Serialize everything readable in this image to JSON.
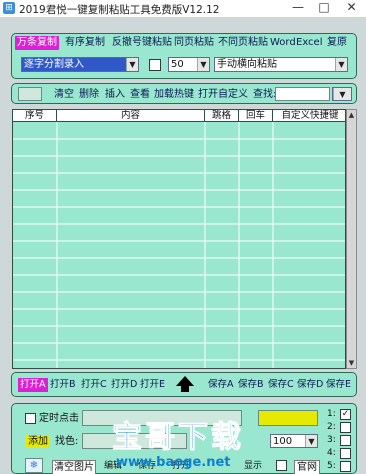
{
  "window": {
    "title": "2019君悦一键复制粘贴工具免费版V12.12",
    "app_icon": "app-icon",
    "minimize": "—",
    "maximize": "□",
    "close": "✕"
  },
  "tabs": [
    {
      "label": "万条复制",
      "active": true
    },
    {
      "label": "有序复制"
    },
    {
      "label": "反撤号键粘贴"
    },
    {
      "label": "同页粘贴"
    },
    {
      "label": "不同页粘贴"
    },
    {
      "label": "Word"
    },
    {
      "label": "Excel"
    },
    {
      "label": "复原"
    }
  ],
  "options": {
    "input_mode": "逐字分割录入",
    "count": "50",
    "paste_mode": "手动横向粘贴"
  },
  "toolbar": {
    "items": [
      "清空",
      "删除",
      "插入",
      "查看",
      "加载热键",
      "打开自定义"
    ],
    "search_label": "查找:"
  },
  "table": {
    "columns": [
      "序号",
      "内容",
      "跳格",
      "回车",
      "自定义快捷键"
    ],
    "rows": []
  },
  "save_bar": {
    "open": [
      "打开A",
      "打开B",
      "打开C",
      "打开D",
      "打开E"
    ],
    "save": [
      "保存A",
      "保存B",
      "保存C",
      "保存D",
      "保存E"
    ],
    "arrow_icon": "up-arrow-icon"
  },
  "bottom": {
    "timer_label": "定时点击",
    "add_label": "添加",
    "find_color_label": "找色:",
    "zoom_value": "100",
    "clear_image_label": "清空图片",
    "edit_label": "编辑",
    "save_label": "保存",
    "open_label": "打开",
    "show_label": "显示",
    "official_label": "官网",
    "number_labels": [
      "1:",
      "2:",
      "3:",
      "4:",
      "5:"
    ]
  },
  "watermark": {
    "text": "宝哥下载",
    "url": "www.baoge.net"
  },
  "colors": {
    "panel_bg": "#9ae7d0",
    "accent": "#dd1fd6",
    "yellow": "#e6ea00",
    "watermark": "#0c7fd0"
  }
}
